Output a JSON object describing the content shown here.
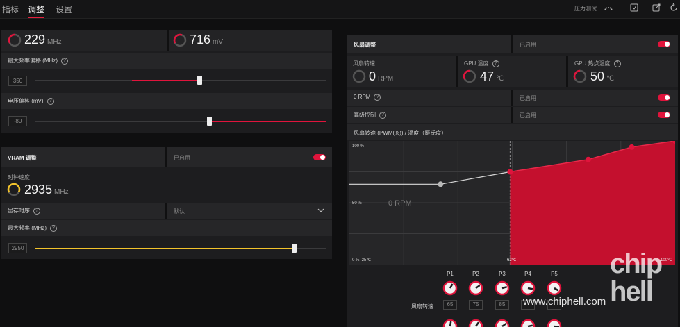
{
  "tabs": [
    {
      "label": "指标"
    },
    {
      "label": "调整"
    },
    {
      "label": "设置"
    }
  ],
  "topbar": {
    "stress_test_label": "压力测试"
  },
  "gpu": {
    "clock_value": "229",
    "clock_unit": "MHz",
    "voltage_value": "716",
    "voltage_unit": "mV",
    "max_freq_offset_label": "最大频率偏移 (MHz)",
    "max_freq_offset_value": "350",
    "max_freq_offset_position": 0.56,
    "voltage_offset_label": "电压偏移 (mV)",
    "voltage_offset_value": "-80",
    "voltage_offset_position": 0.6
  },
  "vram": {
    "title": "VRAM 调整",
    "status": "已启用",
    "clock_label": "时钟速度",
    "clock_value": "2935",
    "clock_unit": "MHz",
    "timing_label": "显存时序",
    "timing_value": "默认",
    "max_freq_label": "最大频率 (MHz)",
    "max_freq_value": "2950",
    "max_freq_position": 0.89
  },
  "fan": {
    "title": "风扇调整",
    "status": "已启用",
    "speed_label": "风扇转速",
    "speed_value": "0",
    "speed_unit": "RPM",
    "gpu_temp_label": "GPU 温度",
    "gpu_temp_value": "47",
    "gpu_temp_unit": "℃",
    "hotspot_label": "GPU 热点温度",
    "hotspot_value": "50",
    "hotspot_unit": "℃",
    "zero_rpm_label": "0 RPM",
    "zero_rpm_status": "已启用",
    "advanced_label": "高级控制",
    "advanced_status": "已启用",
    "curve_title": "风扇转速 (PWM(%)) / 温度（摄氏度）",
    "knob_row_label": "风扇转速",
    "points": [
      {
        "label": "P1",
        "value": "65"
      },
      {
        "label": "P2",
        "value": "75"
      },
      {
        "label": "P3",
        "value": "85"
      },
      {
        "label": "P4",
        "value": ""
      },
      {
        "label": "P5",
        "value": ""
      }
    ]
  },
  "chart_data": {
    "type": "line",
    "x_range": [
      25,
      100
    ],
    "y_range": [
      0,
      100
    ],
    "tick_labels": {
      "top_left": "100 %",
      "mid_left": "50 %",
      "origin": "0 %, 25℃",
      "threshold": "62℃",
      "right": "100℃"
    },
    "zero_rpm_overlay": "0 RPM",
    "inactive_points": [
      {
        "x": 25,
        "y": 65
      },
      {
        "x": 46,
        "y": 65
      }
    ],
    "active_points": [
      {
        "x": 62,
        "y": 75
      },
      {
        "x": 80,
        "y": 85
      },
      {
        "x": 90,
        "y": 95
      },
      {
        "x": 100,
        "y": 100
      }
    ]
  },
  "watermark": {
    "url": "www.chiphell.com",
    "logo": "chip hell"
  },
  "colors": {
    "accent": "#e0143c",
    "vram_accent": "#f2c32b",
    "panel": "#1d1d1f"
  }
}
